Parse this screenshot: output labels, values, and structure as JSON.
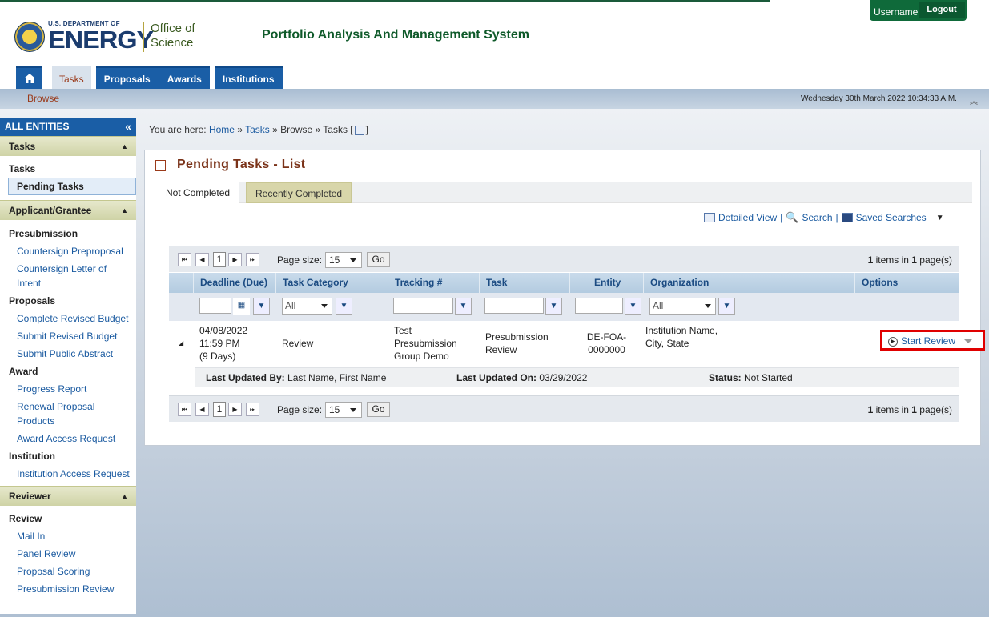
{
  "header": {
    "doe_small": "U.S. DEPARTMENT OF",
    "doe_big": "ENERGY",
    "office_line1": "Office of",
    "office_line2": "Science",
    "app_title": "Portfolio Analysis And Management System",
    "username": "Username",
    "logout": "Logout"
  },
  "nav": {
    "tasks": "Tasks",
    "proposals": "Proposals",
    "awards": "Awards",
    "institutions": "Institutions"
  },
  "subnav": {
    "browse": "Browse",
    "datetime": "Wednesday 30th March 2022 10:34:33 A.M."
  },
  "sidebar": {
    "title": "ALL ENTITIES",
    "tasks_section": "Tasks",
    "tasks_group": "Tasks",
    "pending_tasks": "Pending Tasks",
    "applicant_section": "Applicant/Grantee",
    "presubmission": "Presubmission",
    "countersign_preproposal": "Countersign Preproposal",
    "countersign_loi_1": "Countersign Letter of",
    "countersign_loi_2": "Intent",
    "proposals": "Proposals",
    "complete_revised_budget": "Complete Revised Budget",
    "submit_revised_budget": "Submit Revised Budget",
    "submit_public_abstract": "Submit Public Abstract",
    "award": "Award",
    "progress_report": "Progress Report",
    "renewal_1": "Renewal Proposal",
    "renewal_2": "Products",
    "award_access": "Award Access Request",
    "institution": "Institution",
    "institution_access": "Institution Access Request",
    "reviewer_section": "Reviewer",
    "review": "Review",
    "mail_in": "Mail In",
    "panel_review": "Panel Review",
    "proposal_scoring": "Proposal Scoring",
    "presubmission_review": "Presubmission Review"
  },
  "breadcrumb": {
    "prefix": "You are here:",
    "home": "Home",
    "tasks": "Tasks",
    "browse": "Browse",
    "current": "Tasks ["
  },
  "panel": {
    "title": "Pending Tasks - List",
    "tab_not_completed": "Not Completed",
    "tab_recent": "Recently Completed",
    "detailed_view": "Detailed View",
    "search": "Search",
    "saved_searches": "Saved Searches"
  },
  "pager": {
    "page": "1",
    "page_size_label": "Page size:",
    "page_size": "15",
    "go": "Go",
    "info_count": "1",
    "info_mid": " items in ",
    "info_pages": "1",
    "info_end": " page(s)"
  },
  "columns": {
    "deadline": "Deadline (Due)",
    "category": "Task Category",
    "tracking": "Tracking #",
    "task": "Task",
    "entity": "Entity",
    "organization": "Organization",
    "options": "Options"
  },
  "filters": {
    "all": "All"
  },
  "row": {
    "deadline_date": "04/08/2022",
    "deadline_time": "11:59 PM",
    "deadline_days": "(9 Days)",
    "category": "Review",
    "tracking_1": "Test",
    "tracking_2": "Presubmission",
    "tracking_3": "Group Demo",
    "task_1": "Presubmission",
    "task_2": "Review",
    "entity_1": "DE-FOA-",
    "entity_2": "0000000",
    "org_1": "Institution Name,",
    "org_2": "City, State",
    "start_review": "Start Review"
  },
  "detail": {
    "updated_by_label": "Last Updated By:",
    "updated_by": "Last Name, First Name",
    "updated_on_label": "Last Updated On:",
    "updated_on": "03/29/2022",
    "status_label": "Status:",
    "status": "Not Started"
  }
}
